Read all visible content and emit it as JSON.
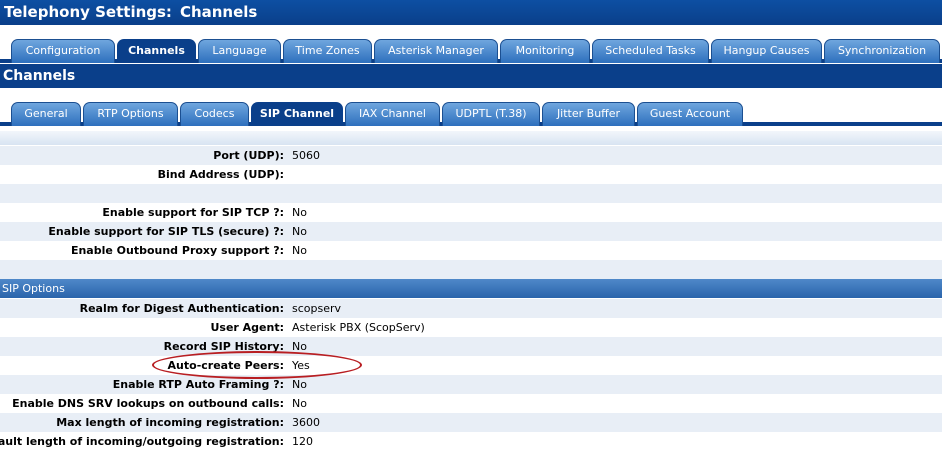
{
  "title": {
    "part1": "Telephony Settings:",
    "part2": "Channels"
  },
  "main_tabs": [
    {
      "label": "Configuration",
      "active": false
    },
    {
      "label": "Channels",
      "active": true
    },
    {
      "label": "Language",
      "active": false
    },
    {
      "label": "Time Zones",
      "active": false
    },
    {
      "label": "Asterisk Manager",
      "active": false
    },
    {
      "label": "Monitoring",
      "active": false
    },
    {
      "label": "Scheduled Tasks",
      "active": false
    },
    {
      "label": "Hangup Causes",
      "active": false
    },
    {
      "label": "Synchronization",
      "active": false
    }
  ],
  "section_title": "Channels",
  "sub_tabs": [
    {
      "label": "General",
      "active": false
    },
    {
      "label": "RTP Options",
      "active": false
    },
    {
      "label": "Codecs",
      "active": false
    },
    {
      "label": "SIP Channel",
      "active": true
    },
    {
      "label": "IAX Channel",
      "active": false
    },
    {
      "label": "UDPTL (T.38)",
      "active": false
    },
    {
      "label": "Jitter Buffer",
      "active": false
    },
    {
      "label": "Guest Account",
      "active": false
    }
  ],
  "general_rows": [
    {
      "label": "Port (UDP):",
      "value": "5060"
    },
    {
      "label": "Bind Address (UDP):",
      "value": ""
    },
    {
      "label": "",
      "value": ""
    },
    {
      "label": "Enable support for SIP TCP ?:",
      "value": "No"
    },
    {
      "label": "Enable support for SIP TLS (secure) ?:",
      "value": "No"
    },
    {
      "label": "Enable Outbound Proxy support ?:",
      "value": "No"
    }
  ],
  "sip_options_header": "SIP Options",
  "sip_option_rows": [
    {
      "label": "Realm for Digest Authentication:",
      "value": "scopserv"
    },
    {
      "label": "User Agent:",
      "value": "Asterisk PBX (ScopServ)"
    },
    {
      "label": "Record SIP History:",
      "value": "No"
    },
    {
      "label": "Auto-create Peers:",
      "value": "Yes"
    },
    {
      "label": "Enable RTP Auto Framing ?:",
      "value": "No"
    },
    {
      "label": "Enable DNS SRV lookups on outbound calls:",
      "value": "No"
    },
    {
      "label": "Max length of incoming registration:",
      "value": "3600"
    },
    {
      "label": "Default length of incoming/outgoing registration:",
      "value": "120"
    }
  ],
  "colors": {
    "title_bg": "#0a3f8a",
    "tab_bg": "#2d6fbd",
    "row_shade": "#e8eef6",
    "highlight": "#b81e22"
  }
}
